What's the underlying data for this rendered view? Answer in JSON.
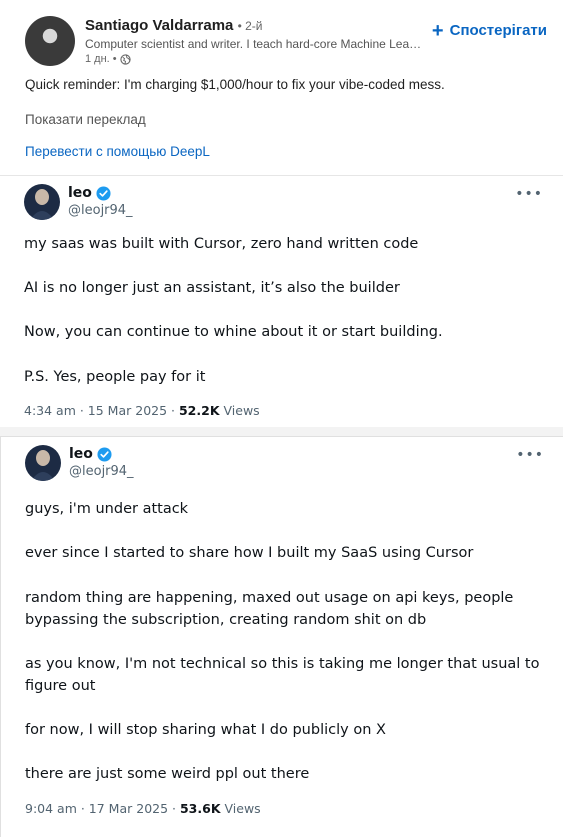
{
  "post": {
    "author_name": "Santiago Valdarrama",
    "author_degree": "• 2-й",
    "author_headline": "Computer scientist and writer. I teach hard-core Machine Lear…",
    "time": "1 дн. •",
    "follow_label": "Спостерігати",
    "text": "Quick reminder: I'm charging $1,000/hour to fix your vibe-coded mess.",
    "show_translation": "Показати переклад",
    "deepl_link": "Перевести с помощью DeepL"
  },
  "tweets": [
    {
      "name": "leo",
      "handle": "@leojr94_",
      "lines": [
        "my saas was built with Cursor, zero hand written code",
        "AI is no longer just an assistant, it’s also the builder",
        "Now, you can continue to whine about it or start building.",
        "P.S. Yes, people pay for it"
      ],
      "time": "4:34 am · 15 Mar 2025 ·",
      "views_count": "52.2K",
      "views_label": "Views"
    },
    {
      "name": "leo",
      "handle": "@leojr94_",
      "lines": [
        "guys, i'm under attack",
        "ever since I started to share how I built my SaaS using Cursor",
        "random thing are happening, maxed out usage on api keys, people",
        "bypassing the subscription, creating random shit on db",
        "as you know, I'm not technical so this is taking me longer that usual to",
        "figure out",
        "for now, I will stop sharing what I do publicly on X",
        "there are just some weird ppl out there"
      ],
      "time": "9:04 am · 17 Mar 2025 ·",
      "views_count": "53.6K",
      "views_label": "Views"
    }
  ],
  "icons": {
    "more": "more-options-icon",
    "verified": "verified-badge-icon",
    "globe": "globe-icon",
    "plus": "plus-icon"
  },
  "colors": {
    "linkedin_blue": "#0a66c2",
    "verified_blue": "#1d9bf0",
    "tweet_secondary": "#536471"
  }
}
